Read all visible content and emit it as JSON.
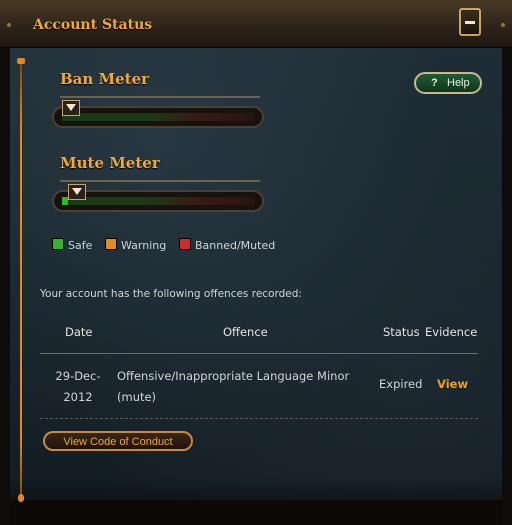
{
  "header": {
    "title": "Account Status"
  },
  "help": {
    "icon": "?",
    "label": "Help"
  },
  "ban_meter": {
    "title": "Ban Meter",
    "level": 0
  },
  "mute_meter": {
    "title": "Mute Meter",
    "level": 0.03
  },
  "legend": [
    {
      "label": "Safe",
      "color": "#2fb82a"
    },
    {
      "label": "Warning",
      "color": "#e0901e"
    },
    {
      "label": "Banned/Muted",
      "color": "#d02a2a"
    }
  ],
  "intro": "Your account has the following offences recorded:",
  "table": {
    "headers": {
      "date": "Date",
      "offence": "Offence",
      "status": "Status",
      "evidence": "Evidence"
    },
    "rows": [
      {
        "date": "29-Dec-2012",
        "offence": "Offensive/Inappropriate Language Minor (mute)",
        "status": "Expired",
        "evidence": "View"
      }
    ]
  },
  "code_of_conduct_label": "View Code of Conduct",
  "icons": {
    "collapse": "minus-icon",
    "help": "question-icon"
  }
}
